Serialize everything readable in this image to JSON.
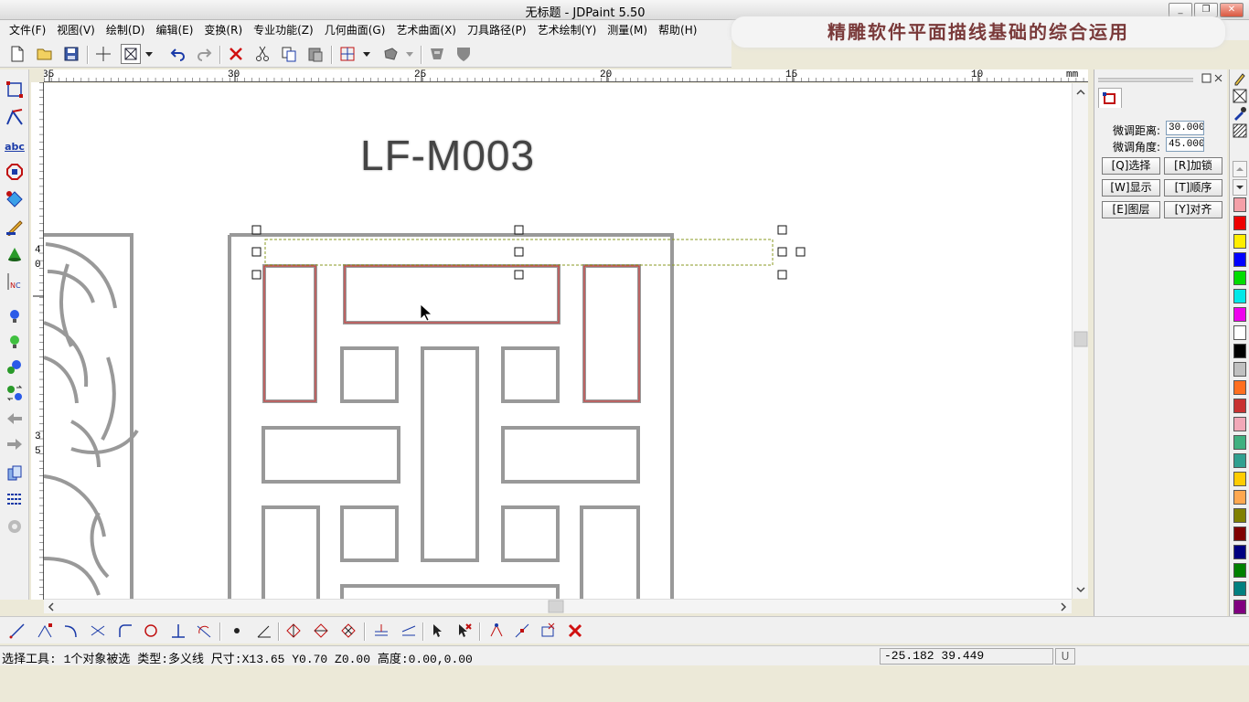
{
  "window": {
    "title": "无标题 - JDPaint 5.50",
    "buttons": {
      "minimize": "_",
      "restore": "❐",
      "close": "✕"
    }
  },
  "banner": {
    "text": "精雕软件平面描线基础的综合运用"
  },
  "menu": {
    "items": [
      "文件(F)",
      "视图(V)",
      "绘制(D)",
      "编辑(E)",
      "变换(R)",
      "专业功能(Z)",
      "几何曲面(G)",
      "艺术曲面(X)",
      "刀具路径(P)",
      "艺术绘制(Y)",
      "测量(M)",
      "帮助(H)"
    ]
  },
  "ruler": {
    "labels": [
      "35",
      "30",
      "25",
      "20",
      "15",
      "10"
    ],
    "unit": "mm",
    "vertical_labels": [
      "4",
      "0",
      "3",
      "5"
    ]
  },
  "canvas": {
    "part_label": "LF-M003"
  },
  "right_panel": {
    "fine_distance_label": "微调距离:",
    "fine_distance_value": "30.000",
    "fine_angle_label": "微调角度:",
    "fine_angle_value": "45.000",
    "buttons": [
      "[Q]选择",
      "[R]加锁",
      "[W]显示",
      "[T]顺序",
      "[E]图层",
      "[Y]对齐"
    ]
  },
  "palette": {
    "colors": [
      "#f4a0a8",
      "#ee0000",
      "#ffee00",
      "#0000ff",
      "#00dd00",
      "#00e8e8",
      "#ee00ee",
      "#ffffff",
      "#000000",
      "#c0c0c0",
      "#ff6f1f",
      "#c83232",
      "#f2a8b8",
      "#40b080",
      "#30a090",
      "#ffcc00",
      "#ffa850",
      "#808000",
      "#800000",
      "#000080",
      "#008000",
      "#008080",
      "#800080",
      "#500090"
    ]
  },
  "icons": {
    "new": "new-file-icon",
    "open": "open-folder-icon",
    "save": "save-icon",
    "undo": "undo-icon",
    "redo": "redo-icon",
    "delete": "delete-icon"
  },
  "status": {
    "text": "选择工具: 1个对象被选 类型:多义线 尺寸:X13.65 Y0.70 Z0.00 高度:0.00,0.00",
    "coords": "-25.182 39.449",
    "unit_box": "U"
  }
}
